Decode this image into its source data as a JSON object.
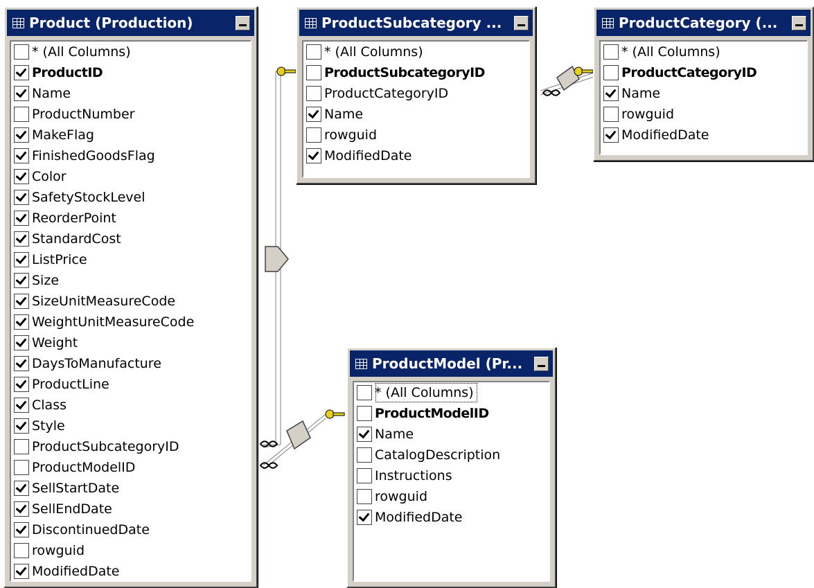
{
  "tables": [
    {
      "title": "Product (Production)",
      "columns": [
        {
          "label": "* (All Columns)",
          "checked": false,
          "key": false
        },
        {
          "label": "ProductID",
          "checked": true,
          "key": true
        },
        {
          "label": "Name",
          "checked": true,
          "key": false
        },
        {
          "label": "ProductNumber",
          "checked": false,
          "key": false
        },
        {
          "label": "MakeFlag",
          "checked": true,
          "key": false
        },
        {
          "label": "FinishedGoodsFlag",
          "checked": true,
          "key": false
        },
        {
          "label": "Color",
          "checked": true,
          "key": false
        },
        {
          "label": "SafetyStockLevel",
          "checked": true,
          "key": false
        },
        {
          "label": "ReorderPoint",
          "checked": true,
          "key": false
        },
        {
          "label": "StandardCost",
          "checked": true,
          "key": false
        },
        {
          "label": "ListPrice",
          "checked": true,
          "key": false
        },
        {
          "label": "Size",
          "checked": true,
          "key": false
        },
        {
          "label": "SizeUnitMeasureCode",
          "checked": true,
          "key": false
        },
        {
          "label": "WeightUnitMeasureCode",
          "checked": true,
          "key": false
        },
        {
          "label": "Weight",
          "checked": true,
          "key": false
        },
        {
          "label": "DaysToManufacture",
          "checked": true,
          "key": false
        },
        {
          "label": "ProductLine",
          "checked": true,
          "key": false
        },
        {
          "label": "Class",
          "checked": true,
          "key": false
        },
        {
          "label": "Style",
          "checked": true,
          "key": false
        },
        {
          "label": "ProductSubcategoryID",
          "checked": false,
          "key": false
        },
        {
          "label": "ProductModelID",
          "checked": false,
          "key": false
        },
        {
          "label": "SellStartDate",
          "checked": true,
          "key": false
        },
        {
          "label": "SellEndDate",
          "checked": true,
          "key": false
        },
        {
          "label": "DiscontinuedDate",
          "checked": true,
          "key": false
        },
        {
          "label": "rowguid",
          "checked": false,
          "key": false
        },
        {
          "label": "ModifiedDate",
          "checked": true,
          "key": false
        }
      ]
    },
    {
      "title": "ProductSubcategory ...",
      "columns": [
        {
          "label": "* (All Columns)",
          "checked": false,
          "key": false
        },
        {
          "label": "ProductSubcategoryID",
          "checked": false,
          "key": true
        },
        {
          "label": "ProductCategoryID",
          "checked": false,
          "key": false
        },
        {
          "label": "Name",
          "checked": true,
          "key": false
        },
        {
          "label": "rowguid",
          "checked": false,
          "key": false
        },
        {
          "label": "ModifiedDate",
          "checked": true,
          "key": false
        }
      ]
    },
    {
      "title": "ProductCategory (...",
      "columns": [
        {
          "label": "* (All Columns)",
          "checked": false,
          "key": false
        },
        {
          "label": "ProductCategoryID",
          "checked": false,
          "key": true
        },
        {
          "label": "Name",
          "checked": true,
          "key": false
        },
        {
          "label": "rowguid",
          "checked": false,
          "key": false
        },
        {
          "label": "ModifiedDate",
          "checked": true,
          "key": false
        }
      ]
    },
    {
      "title": "ProductModel (Pr...",
      "columns": [
        {
          "label": "* (All Columns)",
          "checked": false,
          "key": false,
          "focused": true
        },
        {
          "label": "ProductModelID",
          "checked": false,
          "key": true
        },
        {
          "label": "Name",
          "checked": true,
          "key": false
        },
        {
          "label": "CatalogDescription",
          "checked": false,
          "key": false
        },
        {
          "label": "Instructions",
          "checked": false,
          "key": false
        },
        {
          "label": "rowguid",
          "checked": false,
          "key": false
        },
        {
          "label": "ModifiedDate",
          "checked": true,
          "key": false
        }
      ]
    }
  ],
  "colors": {
    "titlebar": "#0a246a",
    "window": "#d4d0c8",
    "key": "#e8d020"
  }
}
